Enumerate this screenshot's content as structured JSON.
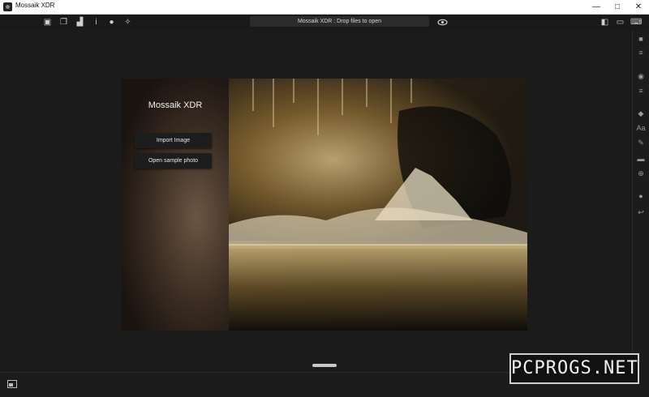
{
  "window": {
    "title": "Mossaik XDR",
    "minimize_glyph": "—",
    "maximize_glyph": "□",
    "close_glyph": "✕"
  },
  "toolbar": {
    "left_icons": [
      {
        "name": "camera-folder-icon",
        "glyph": "▣"
      },
      {
        "name": "copy-icon",
        "glyph": "❐"
      },
      {
        "name": "histogram-icon",
        "glyph": "▟"
      },
      {
        "name": "info-i-icon",
        "glyph": "i"
      },
      {
        "name": "info-circle-icon",
        "glyph": "●"
      },
      {
        "name": "magic-wand-icon",
        "glyph": "✧"
      }
    ],
    "drop_text": "Mossaik XDR : Drop files to open",
    "right_icons": [
      {
        "name": "panel-layout-icon",
        "glyph": "◧"
      },
      {
        "name": "window-icon",
        "glyph": "▭"
      },
      {
        "name": "keyboard-icon",
        "glyph": "⌨"
      }
    ]
  },
  "sidebar": {
    "icons": [
      {
        "name": "briefcase-icon",
        "glyph": "■"
      },
      {
        "name": "sliders-icon",
        "glyph": "≡"
      },
      {
        "name": "target-icon",
        "glyph": "◉"
      },
      {
        "name": "filter-icon",
        "glyph": "≡"
      },
      {
        "name": "layers-icon",
        "glyph": "◆"
      },
      {
        "name": "text-icon",
        "glyph": "Aa"
      },
      {
        "name": "brush-icon",
        "glyph": "✎"
      },
      {
        "name": "frame-icon",
        "glyph": "▬"
      },
      {
        "name": "transform-icon",
        "glyph": "⊕"
      },
      {
        "name": "record-icon",
        "glyph": "●"
      },
      {
        "name": "undo-icon",
        "glyph": "↩"
      }
    ]
  },
  "panel": {
    "app_name": "Mossaik XDR",
    "import_button": "Import Image",
    "sample_button": "Open sample photo"
  },
  "watermark": "PCPROGS.NET",
  "colors": {
    "background": "#1b1b1b",
    "titlebar": "#ffffff",
    "button_bg": "#1d1d1d"
  }
}
